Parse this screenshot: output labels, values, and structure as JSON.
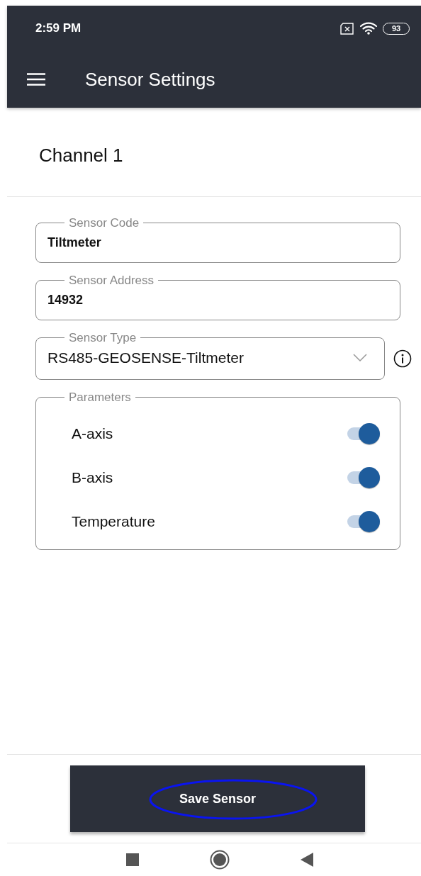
{
  "status_bar": {
    "time": "2:59 PM",
    "battery": "93"
  },
  "app_bar": {
    "title": "Sensor Settings"
  },
  "section_title": "Channel 1",
  "fields": [
    {
      "kind": "text",
      "label": "Sensor Code",
      "value": "Tiltmeter"
    },
    {
      "kind": "text",
      "label": "Sensor Address",
      "value": "14932"
    },
    {
      "kind": "select",
      "label": "Sensor Type",
      "value": "RS485-GEOSENSE-Tiltmeter"
    }
  ],
  "parameters": {
    "label": "Parameters",
    "items": [
      {
        "name": "A-axis",
        "on": true
      },
      {
        "name": "B-axis",
        "on": true
      },
      {
        "name": "Temperature",
        "on": true
      }
    ]
  },
  "save_button": {
    "label": "Save Sensor",
    "highlighted": true
  }
}
